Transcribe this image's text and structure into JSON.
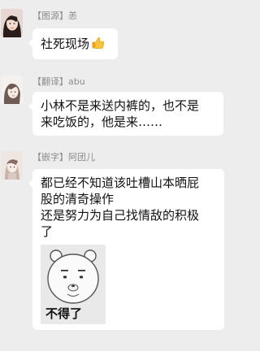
{
  "messages": [
    {
      "tag": "【图源】",
      "name": "恙",
      "avatar_icon": "girl-portrait-avatar",
      "text": "社死现场",
      "emoji_icon": "thumbs-up-icon"
    },
    {
      "tag": "【翻译】",
      "name": "abu",
      "avatar_icon": "girl-sketch-avatar",
      "lines": [
        "小林不是来送内裤的，也不是",
        "来吃饭的，他是来……"
      ]
    },
    {
      "tag": "【嵌字】",
      "name": "阿团儿",
      "avatar_icon": "anime-character-avatar",
      "lines": [
        "都已经不知道该吐槽山本晒屁",
        "股的清奇操作",
        "还是努力为自己找情敌的积极",
        "了"
      ],
      "sticker": {
        "icon": "bear-meme-sticker",
        "caption": "不得了"
      }
    }
  ],
  "colors": {
    "background": "#ededed",
    "bubble": "#ffffff",
    "sender_text": "#8c8c8c",
    "message_text": "#111111"
  }
}
